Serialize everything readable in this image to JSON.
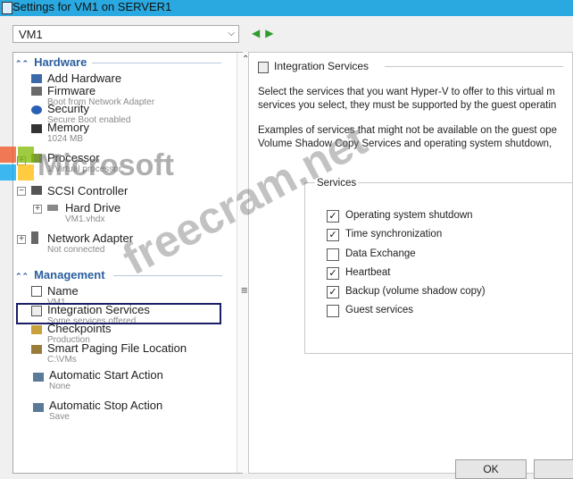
{
  "window": {
    "title": "Settings for VM1 on SERVER1"
  },
  "vm_selector": {
    "value": "VM1"
  },
  "hardware": {
    "header": "Hardware",
    "items": [
      {
        "name": "Add Hardware",
        "sub": ""
      },
      {
        "name": "Firmware",
        "sub": "Boot from Network Adapter"
      },
      {
        "name": "Security",
        "sub": "Secure Boot enabled"
      },
      {
        "name": "Memory",
        "sub": "1024 MB"
      },
      {
        "name": "Processor",
        "sub": "1 Virtual processor"
      },
      {
        "name": "SCSI Controller",
        "sub": ""
      },
      {
        "name": "Hard Drive",
        "sub": "VM1.vhdx"
      },
      {
        "name": "Network Adapter",
        "sub": "Not connected"
      }
    ]
  },
  "management": {
    "header": "Management",
    "items": [
      {
        "name": "Name",
        "sub": "VM1"
      },
      {
        "name": "Integration Services",
        "sub": "Some services offered"
      },
      {
        "name": "Checkpoints",
        "sub": "Production"
      },
      {
        "name": "Smart Paging File Location",
        "sub": "C:\\VMs"
      },
      {
        "name": "Automatic Start Action",
        "sub": "None"
      },
      {
        "name": "Automatic Stop Action",
        "sub": "Save"
      }
    ]
  },
  "integration": {
    "title": "Integration Services",
    "desc1": "Select the services that you want Hyper-V to offer to this virtual m",
    "desc2": "services you select, they must be supported by the guest operatin",
    "ex1": "Examples of services that might not be available on the guest ope",
    "ex2": "Volume Shadow Copy Services and operating system shutdown,",
    "services_label": "Services",
    "services": [
      {
        "label": "Operating system shutdown",
        "checked": true
      },
      {
        "label": "Time synchronization",
        "checked": true
      },
      {
        "label": "Data Exchange",
        "checked": false
      },
      {
        "label": "Heartbeat",
        "checked": true
      },
      {
        "label": "Backup (volume shadow copy)",
        "checked": true
      },
      {
        "label": "Guest services",
        "checked": false
      }
    ]
  },
  "buttons": {
    "ok": "OK"
  },
  "watermark": {
    "ms": "Microsoft",
    "site": "freecram.net"
  },
  "colors": {
    "titlebar": "#2aa9e0",
    "section": "#2a5fa0",
    "highlight": "#1a1f66"
  },
  "icons": {
    "nav_back": "◀",
    "nav_fwd": "▶",
    "check": "✓",
    "dropdown": "⌵",
    "collapse": "⌃"
  }
}
